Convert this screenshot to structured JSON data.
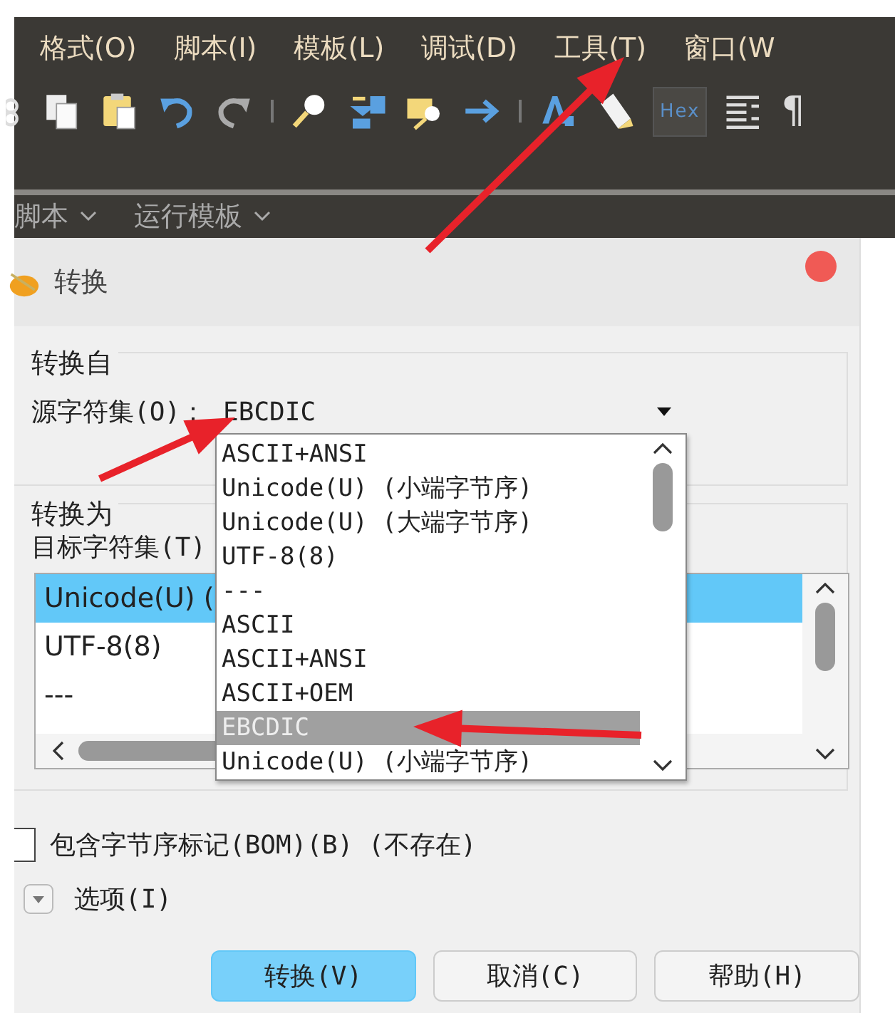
{
  "menu_bar": [
    "格式(O)",
    "脚本(I)",
    "模板(L)",
    "调试(D)",
    "工具(T)",
    "窗口(W"
  ],
  "toolbar": [
    {
      "kind": "cut"
    },
    {
      "kind": "copy"
    },
    {
      "kind": "paste"
    },
    {
      "kind": "undo"
    },
    {
      "kind": "redo"
    },
    {
      "kind": "sep"
    },
    {
      "kind": "find"
    },
    {
      "kind": "replace"
    },
    {
      "kind": "find-files"
    },
    {
      "kind": "goto"
    },
    {
      "kind": "sep"
    },
    {
      "kind": "font"
    },
    {
      "kind": "highlight"
    },
    {
      "kind": "text",
      "label": "Hex"
    },
    {
      "kind": "wrap"
    },
    {
      "kind": "text",
      "label": "¶"
    }
  ],
  "sub_menu": [
    "脚本",
    "运行模板"
  ],
  "dialog": {
    "title": "转换",
    "from_group": {
      "title": "转换自",
      "label": "源字符集(O)：",
      "value": "EBCDIC",
      "dropdown": [
        {
          "label": "ASCII+ANSI",
          "selected": false
        },
        {
          "label": "Unicode(U) (小端字节序)",
          "selected": false
        },
        {
          "label": "Unicode(U) (大端字节序)",
          "selected": false
        },
        {
          "label": "UTF-8(8)",
          "selected": false
        },
        {
          "label": "---",
          "selected": false
        },
        {
          "label": "ASCII",
          "selected": false
        },
        {
          "label": "ASCII+ANSI",
          "selected": false
        },
        {
          "label": "ASCII+OEM",
          "selected": false
        },
        {
          "label": "EBCDIC",
          "selected": true
        },
        {
          "label": "Unicode(U) (小端字节序)",
          "selected": false
        }
      ]
    },
    "to_group": {
      "title": "转换为",
      "label": "目标字符集(T)",
      "items": [
        {
          "label": "Unicode(U) (",
          "selected": true
        },
        {
          "label": "UTF-8(8)",
          "selected": false
        },
        {
          "label": "---",
          "selected": false
        }
      ]
    },
    "bom": {
      "label": "包含字节序标记(BOM)(B) (不存在)",
      "checked": false
    },
    "options": {
      "label": "选项(I)",
      "expanded": false
    },
    "buttons": [
      {
        "label": "转换(V)",
        "primary": true
      },
      {
        "label": "取消(C)",
        "primary": false
      },
      {
        "label": "帮助(H)",
        "primary": false
      }
    ]
  },
  "annotations": [
    {
      "kind": "arrow"
    },
    {
      "kind": "arrow"
    },
    {
      "kind": "arrow"
    }
  ]
}
